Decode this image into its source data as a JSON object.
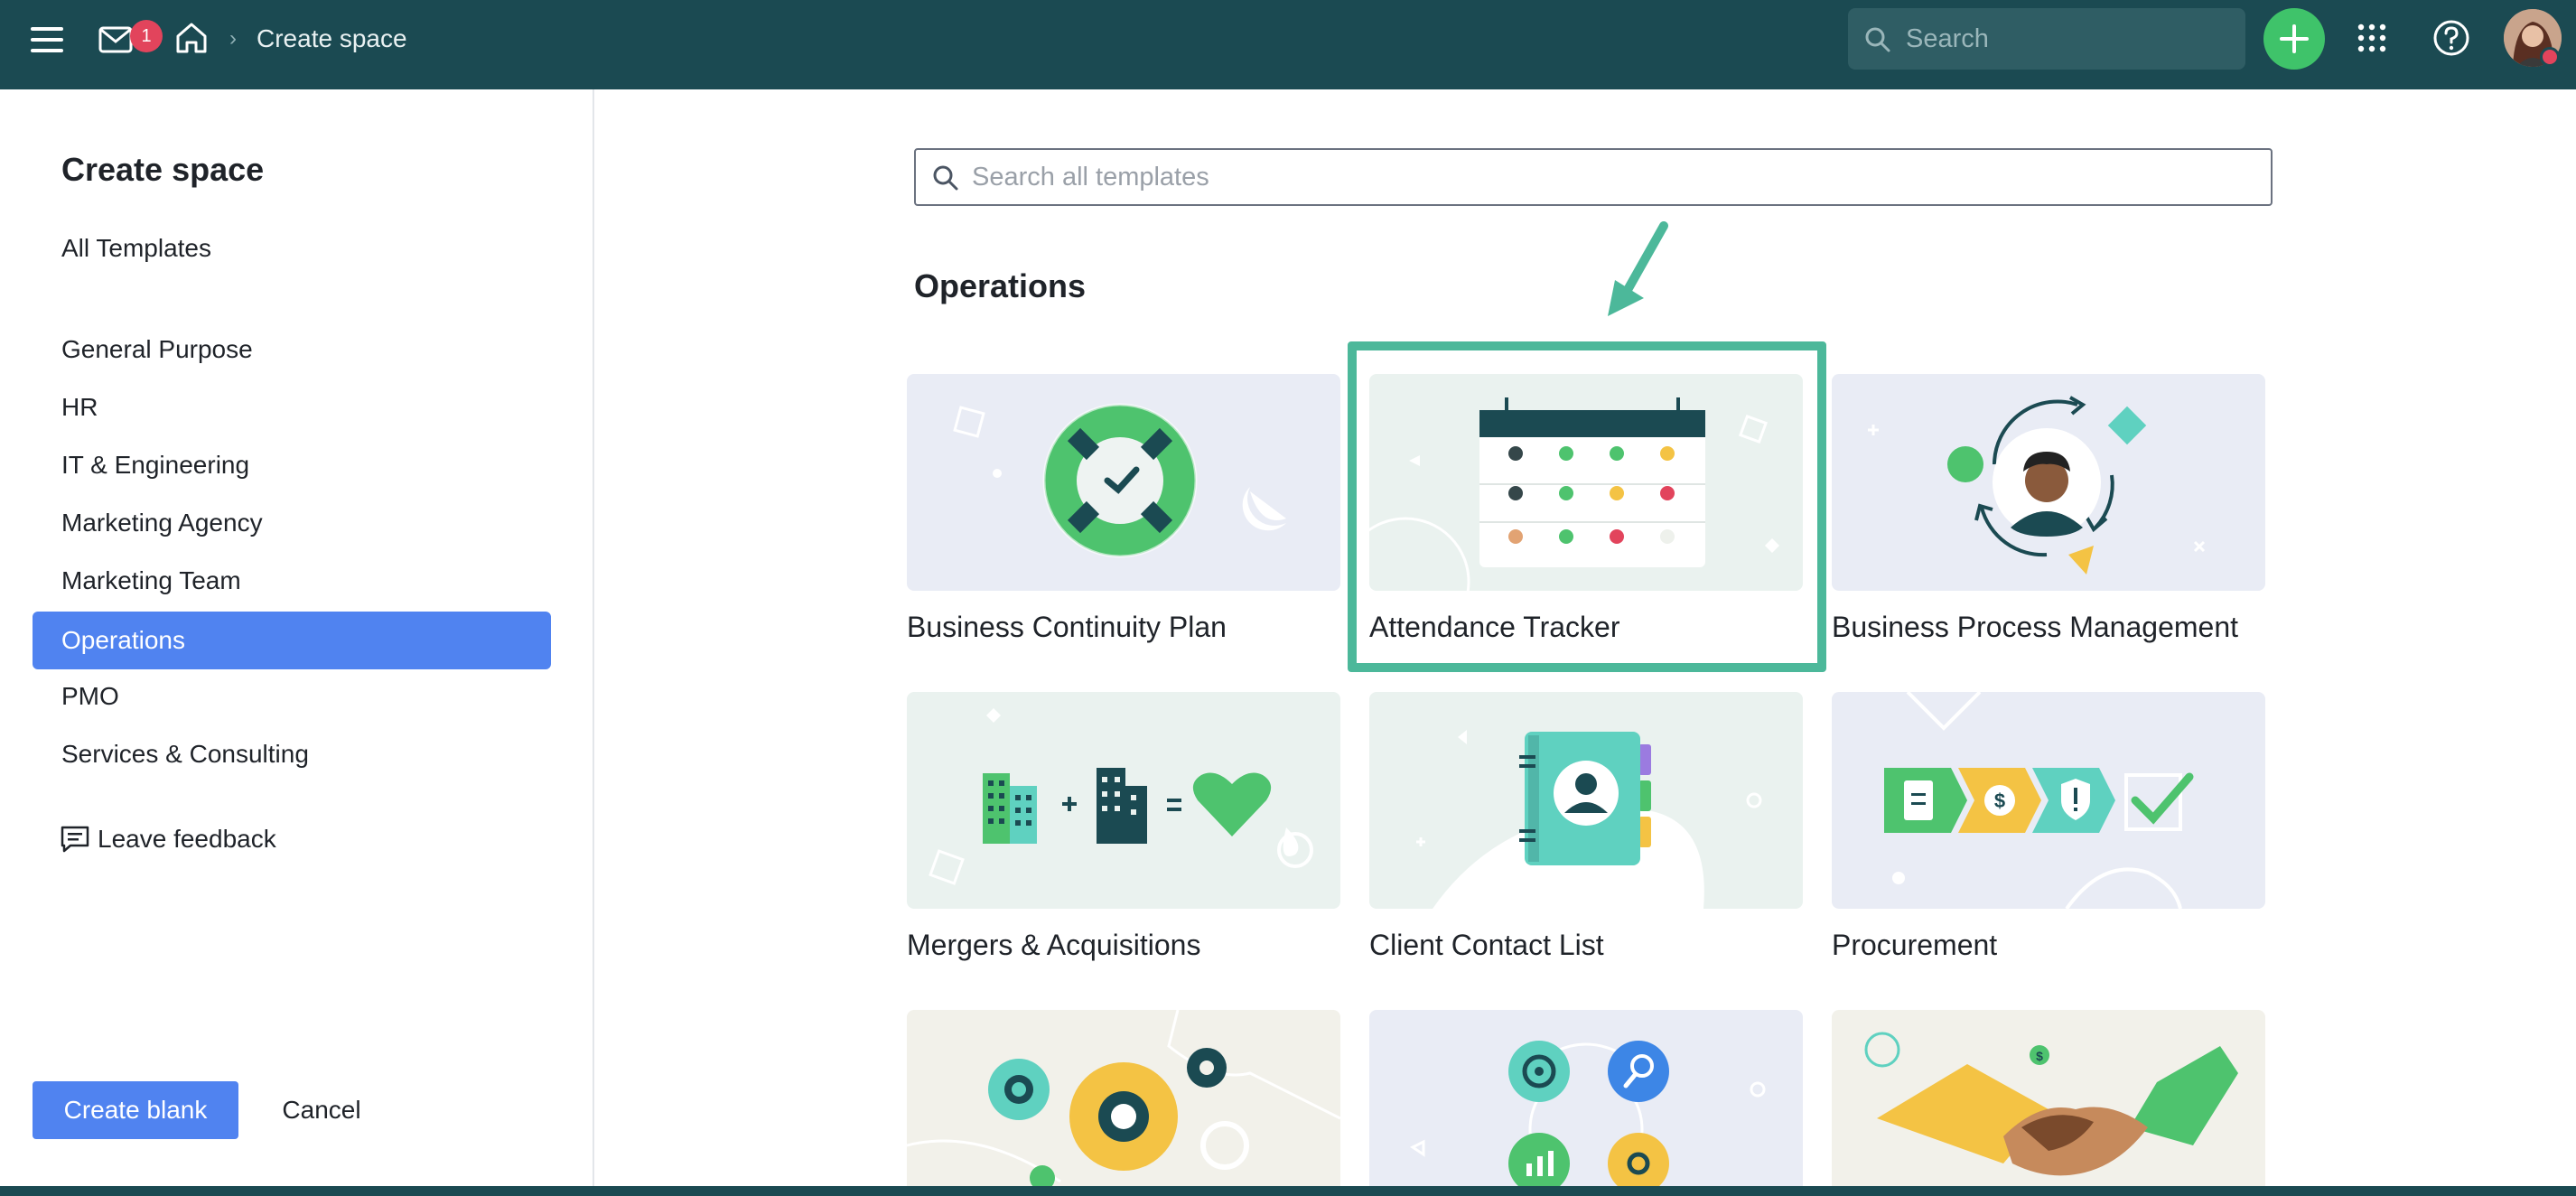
{
  "topbar": {
    "mail_badge": "1",
    "breadcrumb": "Create space",
    "search_placeholder": "Search"
  },
  "sidebar": {
    "title": "Create space",
    "all_templates": "All Templates",
    "categories": [
      "General Purpose",
      "HR",
      "IT & Engineering",
      "Marketing Agency",
      "Marketing Team",
      "Operations",
      "PMO",
      "Services & Consulting"
    ],
    "active_category": "Operations",
    "feedback": "Leave feedback",
    "create_blank": "Create blank",
    "cancel": "Cancel"
  },
  "main": {
    "search_placeholder": "Search all templates",
    "section_title": "Operations",
    "templates": [
      {
        "name": "Business Continuity Plan"
      },
      {
        "name": "Attendance Tracker"
      },
      {
        "name": "Business Process Management"
      },
      {
        "name": "Mergers & Acquisitions"
      },
      {
        "name": "Client Contact List"
      },
      {
        "name": "Procurement"
      }
    ]
  },
  "colors": {
    "topbar": "#1b4a52",
    "accent_blue": "#5083f0",
    "highlight_green": "#4cb89a",
    "plus_green": "#3fc36a",
    "badge_red": "#e2445c"
  }
}
